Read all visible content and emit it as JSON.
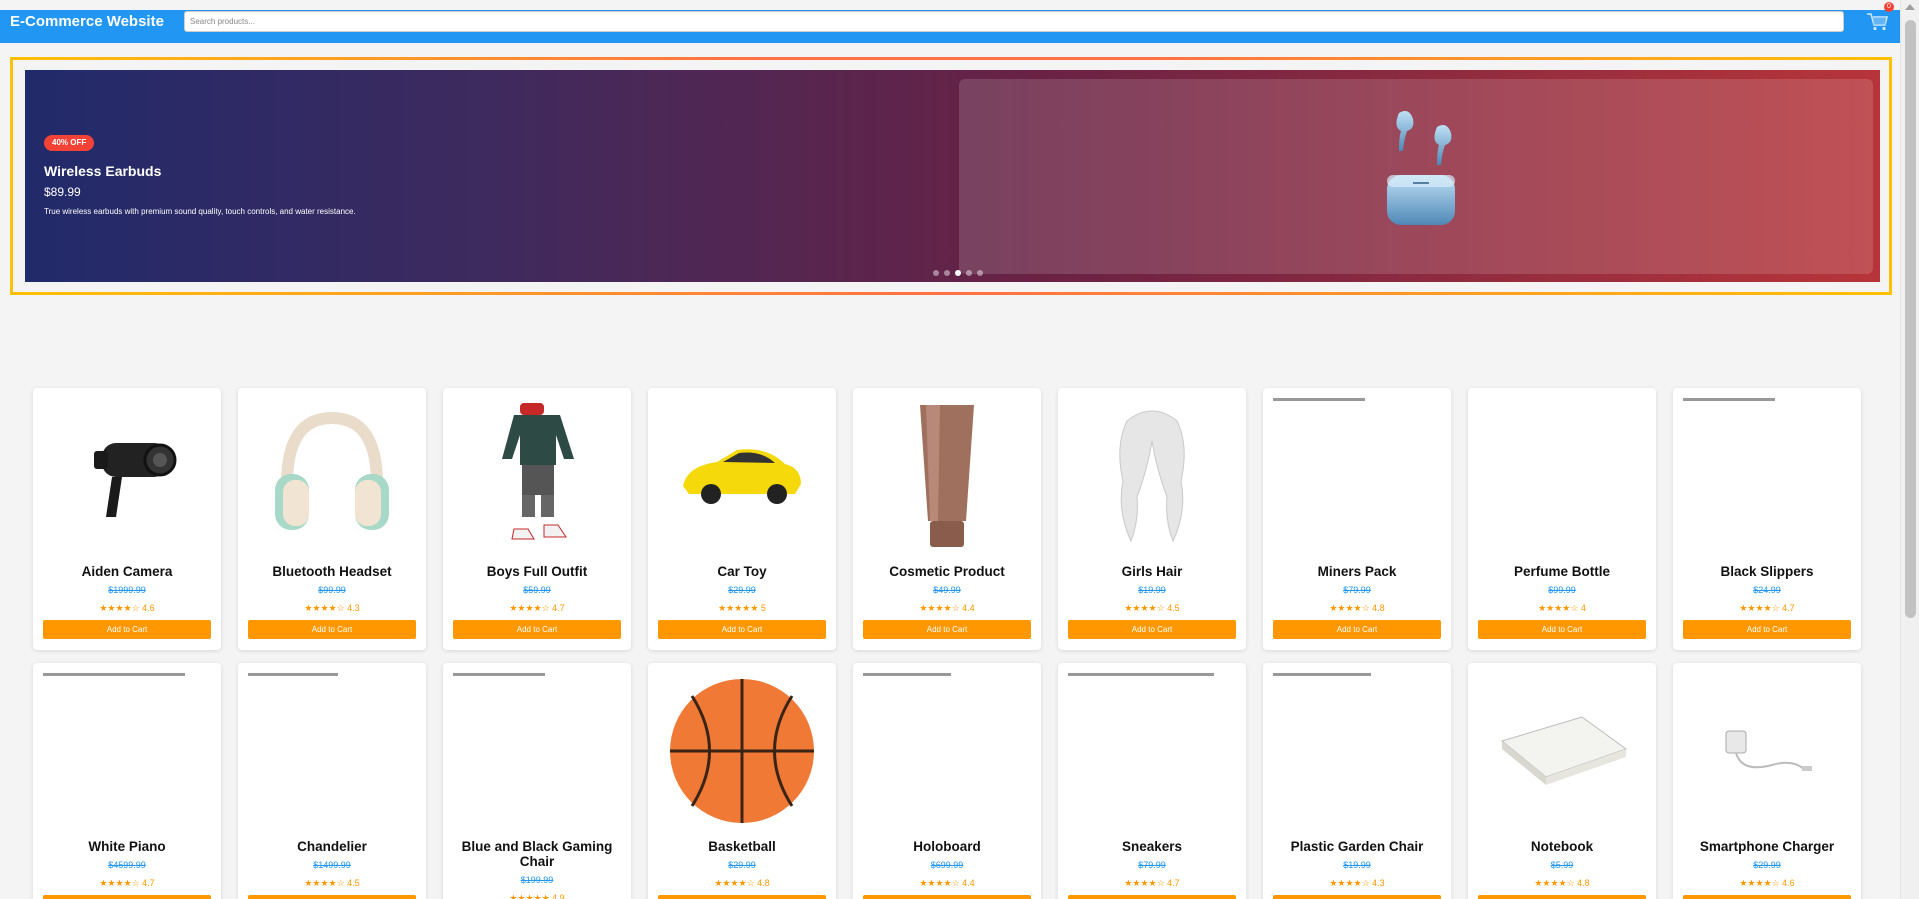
{
  "header": {
    "brand": "E-Commerce Website",
    "search_placeholder": "Search products...",
    "cart_count": "0"
  },
  "carousel": {
    "badge": "40% OFF",
    "title": "Wireless Earbuds",
    "price": "$89.99",
    "description": "True wireless earbuds with premium sound quality, touch controls, and water resistance.",
    "slide_count": 5,
    "active_slide": 3
  },
  "products": [
    {
      "name": "Aiden Camera",
      "price": "$1999.99",
      "rating": "★★★★☆ 4.6",
      "button": "Add to Cart",
      "image": "security-camera-icon"
    },
    {
      "name": "Bluetooth Headset",
      "price": "$99.99",
      "rating": "★★★★☆ 4.3",
      "button": "Add to Cart",
      "image": "headphones-icon"
    },
    {
      "name": "Boys Full Outfit",
      "price": "$59.99",
      "rating": "★★★★☆ 4.7",
      "button": "Add to Cart",
      "image": "outfit-icon"
    },
    {
      "name": "Car Toy",
      "price": "$29.99",
      "rating": "★★★★★ 5",
      "button": "Add to Cart",
      "image": "car-icon"
    },
    {
      "name": "Cosmetic Product",
      "price": "$49.99",
      "rating": "★★★★☆ 4.4",
      "button": "Add to Cart",
      "image": "cosmetic-tube-icon"
    },
    {
      "name": "Girls Hair",
      "price": "$19.99",
      "rating": "★★★★☆ 4.5",
      "button": "Add to Cart",
      "image": "hair-icon"
    },
    {
      "name": "Miners Pack",
      "price": "$79.99",
      "rating": "★★★★☆ 4.8",
      "button": "Add to Cart",
      "image": "loading-placeholder"
    },
    {
      "name": "Perfume Bottle",
      "price": "$99.99",
      "rating": "★★★★☆ 4",
      "button": "Add to Cart",
      "image": "blank"
    },
    {
      "name": "Black Slippers",
      "price": "$24.99",
      "rating": "★★★★☆ 4.7",
      "button": "Add to Cart",
      "image": "loading-placeholder"
    },
    {
      "name": "White Piano",
      "price": "$4599.99",
      "rating": "★★★★☆ 4.7",
      "button": "Add to Cart",
      "image": "loading-placeholder"
    },
    {
      "name": "Chandelier",
      "price": "$1499.99",
      "rating": "★★★★☆ 4.5",
      "button": "Add to Cart",
      "image": "loading-placeholder"
    },
    {
      "name": "Blue and Black Gaming Chair",
      "price": "$199.99",
      "rating": "★★★★★ 4.9",
      "button": "Add to Cart",
      "image": "loading-placeholder"
    },
    {
      "name": "Basketball",
      "price": "$29.99",
      "rating": "★★★★☆ 4.8",
      "button": "Add to Cart",
      "image": "basketball-icon"
    },
    {
      "name": "Holoboard",
      "price": "$699.99",
      "rating": "★★★★☆ 4.4",
      "button": "Add to Cart",
      "image": "loading-placeholder"
    },
    {
      "name": "Sneakers",
      "price": "$79.99",
      "rating": "★★★★☆ 4.7",
      "button": "Add to Cart",
      "image": "loading-placeholder"
    },
    {
      "name": "Plastic Garden Chair",
      "price": "$19.99",
      "rating": "★★★★☆ 4.3",
      "button": "Add to Cart",
      "image": "loading-placeholder"
    },
    {
      "name": "Notebook",
      "price": "$5.99",
      "rating": "★★★★☆ 4.8",
      "button": "Add to Cart",
      "image": "notebook-icon"
    },
    {
      "name": "Smartphone Charger",
      "price": "$29.99",
      "rating": "★★★★☆ 4.6",
      "button": "Add to Cart",
      "image": "charger-icon"
    }
  ],
  "colors": {
    "header": "#2196f3",
    "accent": "#ff9800",
    "price": "#2196f3",
    "badge": "#f44336",
    "carousel_border": "#ffc107"
  }
}
